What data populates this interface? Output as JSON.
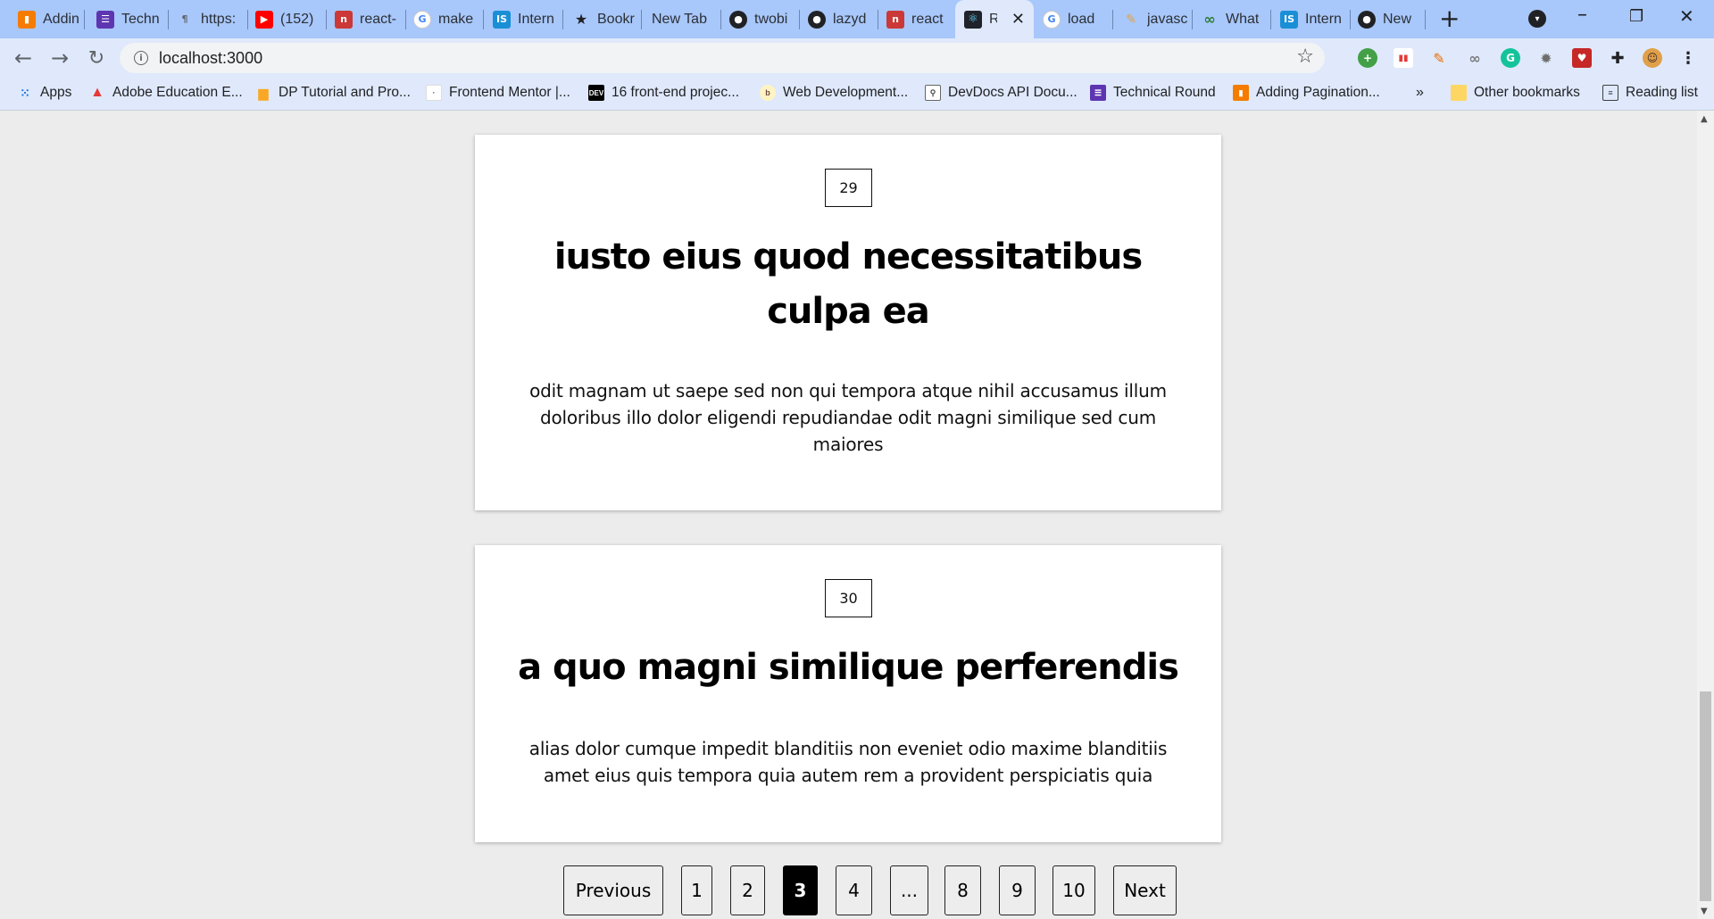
{
  "browser": {
    "tabs": [
      {
        "title": "Addin",
        "icon": "bookmark-orange-icon",
        "color": "#f57c00"
      },
      {
        "title": "Techn",
        "icon": "list-purple-icon",
        "color": "#5e35b1"
      },
      {
        "title": "https:",
        "icon": "dictionary-icon",
        "color": "#5f6368"
      },
      {
        "title": "(152)",
        "icon": "youtube-icon",
        "color": "#ff0000"
      },
      {
        "title": "react-",
        "icon": "npm-icon",
        "color": "#cb3837"
      },
      {
        "title": "make",
        "icon": "google-icon",
        "color": "#4285f4"
      },
      {
        "title": "Intern",
        "icon": "interviewbit-icon",
        "color": "#1b8fd6"
      },
      {
        "title": "Bookr",
        "icon": "star-icon",
        "color": "#202124"
      },
      {
        "title": "New Tab",
        "icon": "",
        "color": "#202124"
      },
      {
        "title": "twobi",
        "icon": "github-icon",
        "color": "#202124"
      },
      {
        "title": "lazyd",
        "icon": "github-icon",
        "color": "#202124"
      },
      {
        "title": "react",
        "icon": "npm-icon",
        "color": "#cb3837"
      },
      {
        "title": "Re",
        "icon": "react-icon",
        "color": "#20232a",
        "active": true
      },
      {
        "title": "load",
        "icon": "google-icon",
        "color": "#4285f4"
      },
      {
        "title": "javasc",
        "icon": "pen-icon",
        "color": "#e8a23b"
      },
      {
        "title": "What",
        "icon": "infinity-icon",
        "color": "#2e7d32"
      },
      {
        "title": "Intern",
        "icon": "interviewbit-icon",
        "color": "#1b8fd6"
      },
      {
        "title": "New",
        "icon": "github-icon",
        "color": "#202124"
      }
    ],
    "address": "localhost:3000",
    "bookmarks": [
      {
        "label": "Apps",
        "icon": "apps-grid-icon"
      },
      {
        "label": "Adobe Education E...",
        "icon": "adobe-icon"
      },
      {
        "label": "DP Tutorial and Pro...",
        "icon": "bar-chart-icon"
      },
      {
        "label": "Frontend Mentor |...",
        "icon": "frontend-mentor-icon"
      },
      {
        "label": "16 front-end projec...",
        "icon": "dev-icon"
      },
      {
        "label": "Web Development...",
        "icon": "web-dev-icon"
      },
      {
        "label": "DevDocs API Docu...",
        "icon": "devdocs-icon"
      },
      {
        "label": "Technical Round",
        "icon": "list-purple-icon"
      },
      {
        "label": "Adding Pagination...",
        "icon": "bookmark-orange-icon"
      }
    ],
    "bookmarks_overflow": "»",
    "other_bookmarks": "Other bookmarks",
    "reading_list": "Reading list"
  },
  "posts": [
    {
      "id": "29",
      "title": "iusto eius quod necessitatibus culpa ea",
      "body": "odit magnam ut saepe sed non qui tempora atque nihil accusamus illum doloribus illo dolor eligendi repudiandae odit magni similique sed cum maiores"
    },
    {
      "id": "30",
      "title": "a quo magni similique perferendis",
      "body": "alias dolor cumque impedit blanditiis non eveniet odio maxime blanditiis amet eius quis tempora quia autem rem a provident perspiciatis quia"
    }
  ],
  "pagination": {
    "previous": "Previous",
    "pages": [
      "1",
      "2",
      "3",
      "4",
      "...",
      "8",
      "9",
      "10"
    ],
    "current": "3",
    "next": "Next"
  },
  "colors": {
    "tabstrip": "#a8c7fa",
    "toolbar": "#dfe9fb",
    "page_bg": "#ececec",
    "active_page": "#000000"
  }
}
